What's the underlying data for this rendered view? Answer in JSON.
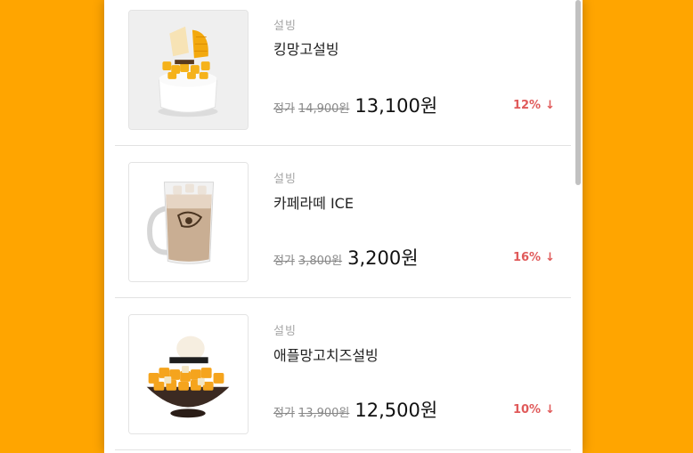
{
  "products": [
    {
      "category": "설빙",
      "name": "킹망고설빙",
      "original_label": "정가",
      "original_price": "14,900원",
      "sale_price": "13,100원",
      "discount": "12%",
      "discount_icon": "arrow-down-icon",
      "image_icon": "mango-bingsu-image"
    },
    {
      "category": "설빙",
      "name": "카페라떼 ICE",
      "original_label": "정가",
      "original_price": "3,800원",
      "sale_price": "3,200원",
      "discount": "16%",
      "discount_icon": "arrow-down-icon",
      "image_icon": "iced-latte-image"
    },
    {
      "category": "설빙",
      "name": "애플망고치즈설빙",
      "original_label": "정가",
      "original_price": "13,900원",
      "sale_price": "12,500원",
      "discount": "10%",
      "discount_icon": "arrow-down-icon",
      "image_icon": "apple-mango-cheese-bingsu-image"
    }
  ],
  "colors": {
    "background": "#FFA500",
    "discount": "#e05a5a",
    "category": "#a6a6a6"
  }
}
